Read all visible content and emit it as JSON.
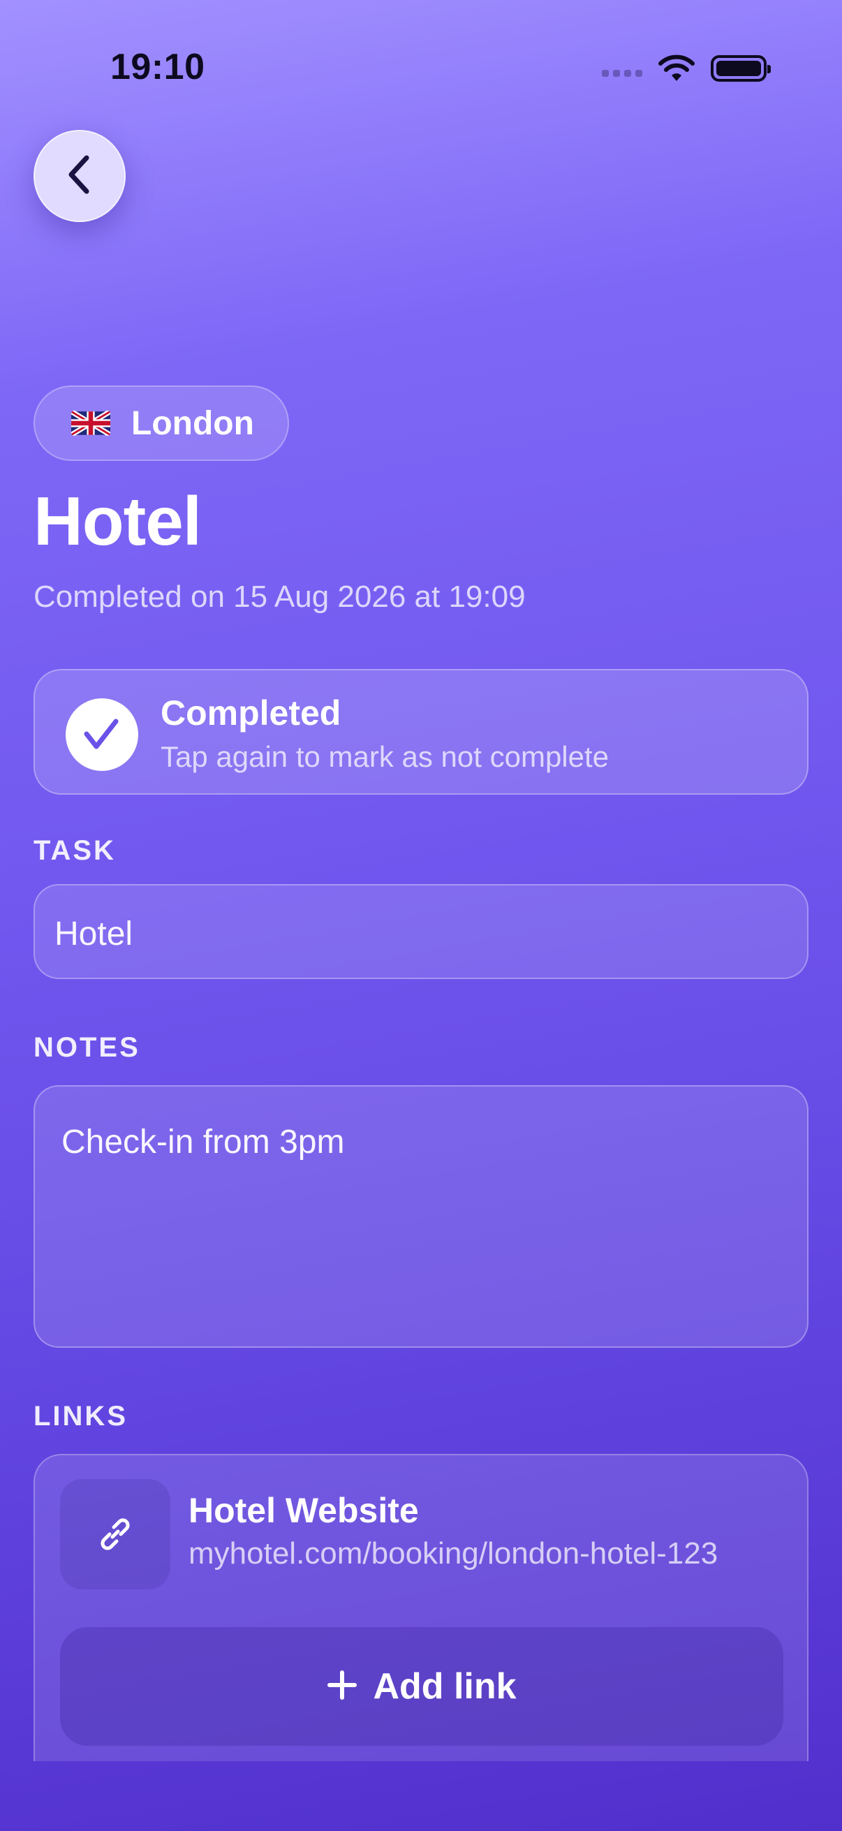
{
  "status_bar": {
    "time": "19:10"
  },
  "location": {
    "flag": "uk-flag-icon",
    "name": "London"
  },
  "task": {
    "title": "Hotel",
    "completed_text": "Completed on 15 Aug 2026 at 19:09"
  },
  "completion": {
    "title": "Completed",
    "hint": "Tap again to mark as not complete"
  },
  "task_section": {
    "label": "TASK",
    "value": "Hotel"
  },
  "notes_section": {
    "label": "NOTES",
    "value": "Check-in from 3pm"
  },
  "links_section": {
    "label": "LINKS",
    "items": [
      {
        "title": "Hotel Website",
        "url": "myhotel.com/booking/london-hotel-123",
        "icon": "link-icon"
      }
    ],
    "add_label": "Add link"
  },
  "colors": {
    "gradient_top": "#a291ff",
    "gradient_bottom": "#512fcc",
    "check_accent": "#6a52e8"
  }
}
